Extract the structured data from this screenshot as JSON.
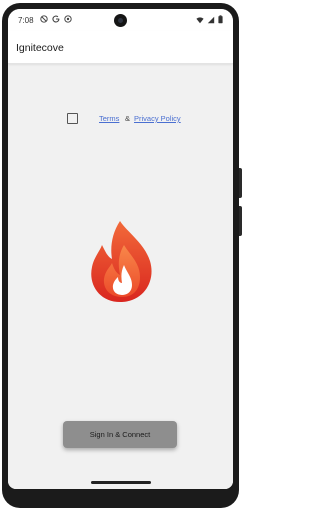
{
  "status_bar": {
    "time": "7:08",
    "left_icons": [
      "do-not-disturb-icon",
      "google-icon",
      "app-notification-icon"
    ],
    "right_icons": [
      "wifi-icon",
      "signal-icon",
      "battery-icon"
    ]
  },
  "app_bar": {
    "title": "Ignitecove"
  },
  "consent": {
    "checked": false,
    "terms_label": "Terms",
    "separator": "&",
    "privacy_label": "Privacy Policy"
  },
  "logo": {
    "icon": "flame-logo-icon",
    "colors": {
      "outer": "#e8432a",
      "inner": "#f57a3c",
      "highlight": "#ffffff"
    }
  },
  "actions": {
    "signin_label": "Sign In & Connect"
  },
  "theme": {
    "background": "#f1f1f1",
    "link": "#4a6fd1",
    "button_bg": "#8e8e8e"
  }
}
